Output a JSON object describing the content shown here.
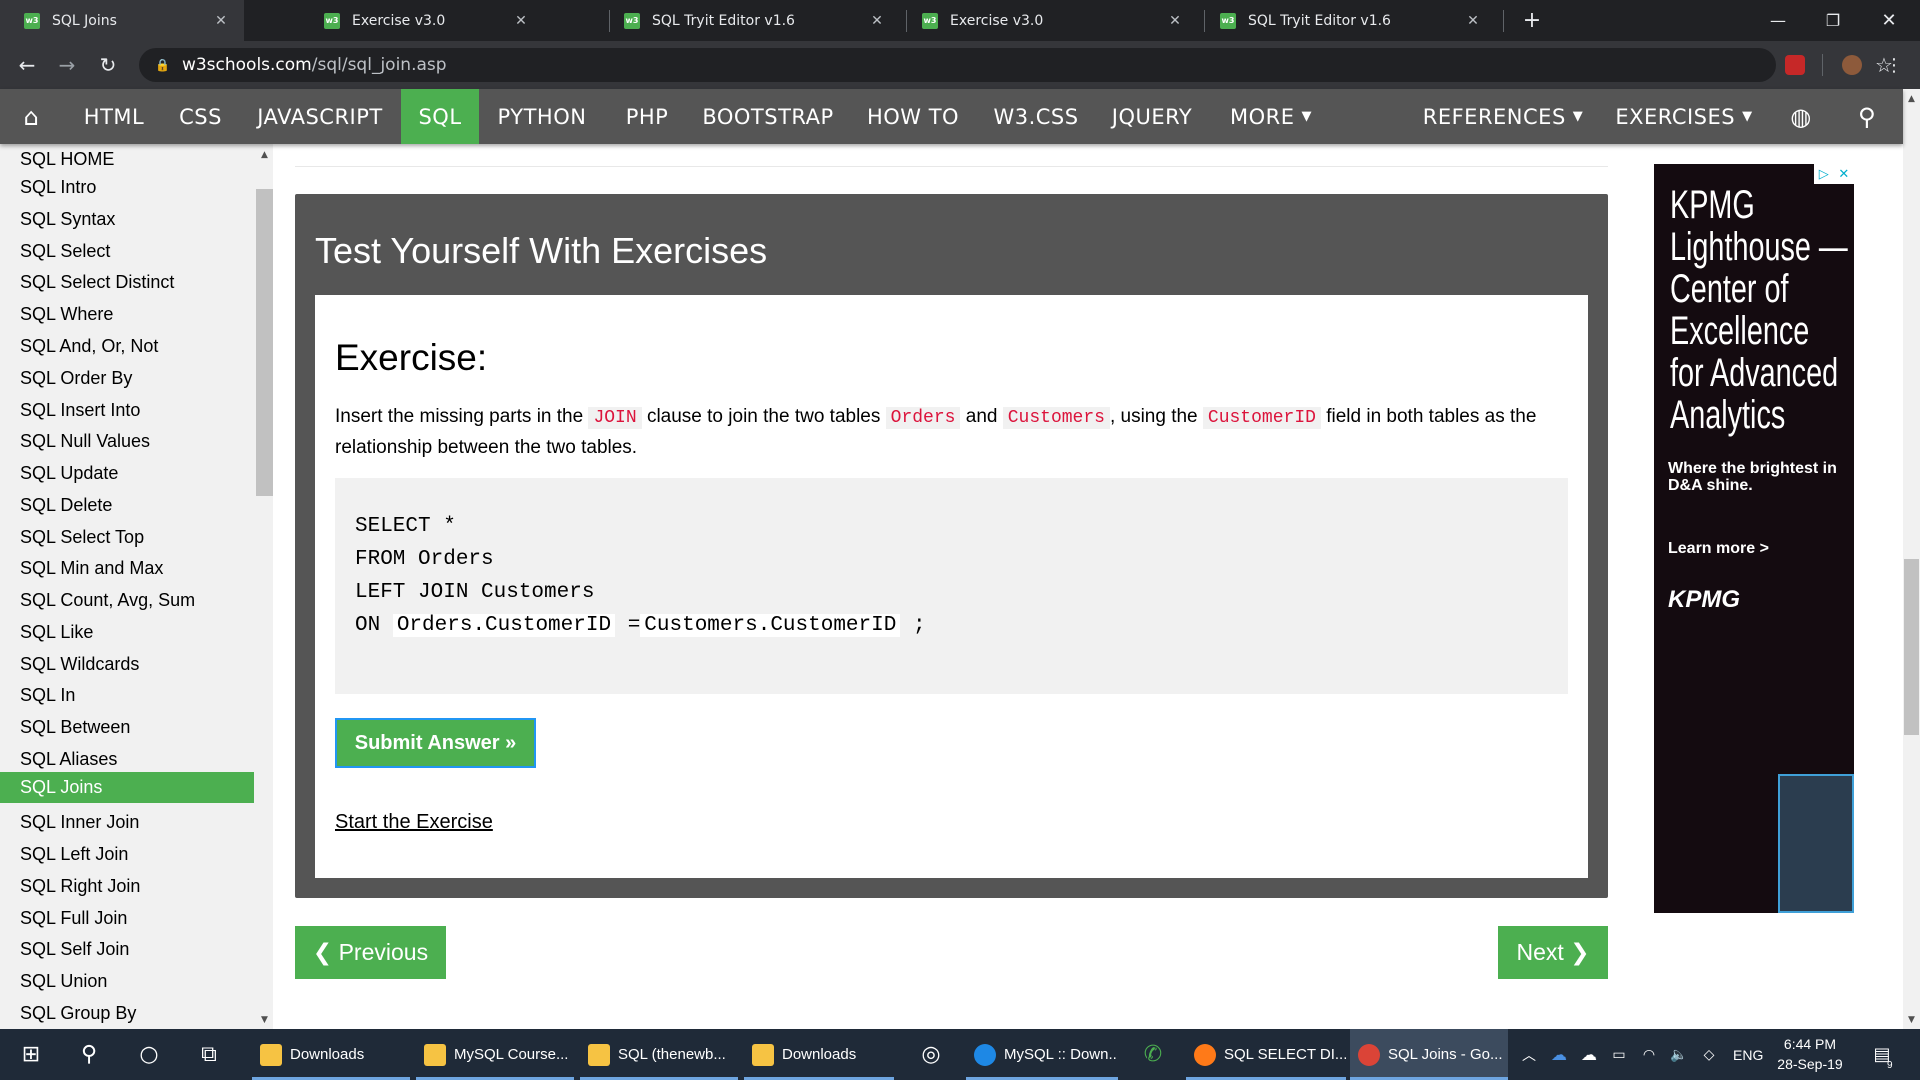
{
  "browser": {
    "tabs": [
      {
        "title": "SQL Joins",
        "favicon": "w3"
      },
      {
        "title": "Exercise v3.0",
        "favicon": "w3"
      },
      {
        "title": "SQL Tryit Editor v1.6",
        "favicon": "w3"
      },
      {
        "title": "Exercise v3.0",
        "favicon": "w3"
      },
      {
        "title": "SQL Tryit Editor v1.6",
        "favicon": "w3"
      }
    ],
    "url_host": "w3schools.com",
    "url_path": "/sql/sql_join.asp"
  },
  "topnav": {
    "items": [
      "HTML",
      "CSS",
      "JAVASCRIPT",
      "SQL",
      "PYTHON",
      "PHP",
      "BOOTSTRAP",
      "HOW TO",
      "W3.CSS",
      "JQUERY",
      "MORE"
    ],
    "selected": "SQL",
    "references": "REFERENCES",
    "exercises": "EXERCISES"
  },
  "sidebar": {
    "items": [
      "SQL HOME",
      "SQL Intro",
      "SQL Syntax",
      "SQL Select",
      "SQL Select Distinct",
      "SQL Where",
      "SQL And, Or, Not",
      "SQL Order By",
      "SQL Insert Into",
      "SQL Null Values",
      "SQL Update",
      "SQL Delete",
      "SQL Select Top",
      "SQL Min and Max",
      "SQL Count, Avg, Sum",
      "SQL Like",
      "SQL Wildcards",
      "SQL In",
      "SQL Between",
      "SQL Aliases",
      "SQL Joins",
      "SQL Inner Join",
      "SQL Left Join",
      "SQL Right Join",
      "SQL Full Join",
      "SQL Self Join",
      "SQL Union",
      "SQL Group By"
    ],
    "selected": "SQL Joins"
  },
  "exercise": {
    "box_title": "Test Yourself With Exercises",
    "heading": "Exercise:",
    "desc_1": "Insert the missing parts in the",
    "code_join": "JOIN",
    "desc_2": "clause to join the two tables",
    "code_orders": "Orders",
    "desc_3": "and",
    "code_customers": "Customers",
    "desc_4": ", using the",
    "code_customerid": "CustomerID",
    "desc_5": "field in both tables as the relationship between the two tables.",
    "code_line1": "SELECT *",
    "code_line2": "FROM Orders",
    "code_line3": "LEFT JOIN Customers",
    "code_line4_a": "ON",
    "blank1": "Orders.CustomerID",
    "code_line4_b": "=",
    "blank2": "Customers.CustomerID",
    "code_line4_c": ";",
    "submit_label": "Submit Answer »",
    "start_label": "Start the Exercise"
  },
  "pager": {
    "previous": "❮ Previous",
    "next": "Next ❯"
  },
  "ad": {
    "title": "KPMG Lighthouse — Center of Excellence for Advanced Analytics",
    "subtitle": "Where the brightest in D&A shine.",
    "cta": "Learn more >",
    "logo": "KPMG"
  },
  "taskbar": {
    "apps": [
      "Downloads",
      "MySQL Course...",
      "SQL (thenewb...",
      "Downloads",
      "MySQL :: Down...",
      "SQL SELECT DI...",
      "SQL Joins - Go..."
    ],
    "lang": "ENG",
    "time": "6:44 PM",
    "date": "28-Sep-19",
    "notifications": "9"
  },
  "colors": {
    "brand_green": "#4caf50",
    "nav_bg": "#555555",
    "code_red": "#dc143c"
  }
}
